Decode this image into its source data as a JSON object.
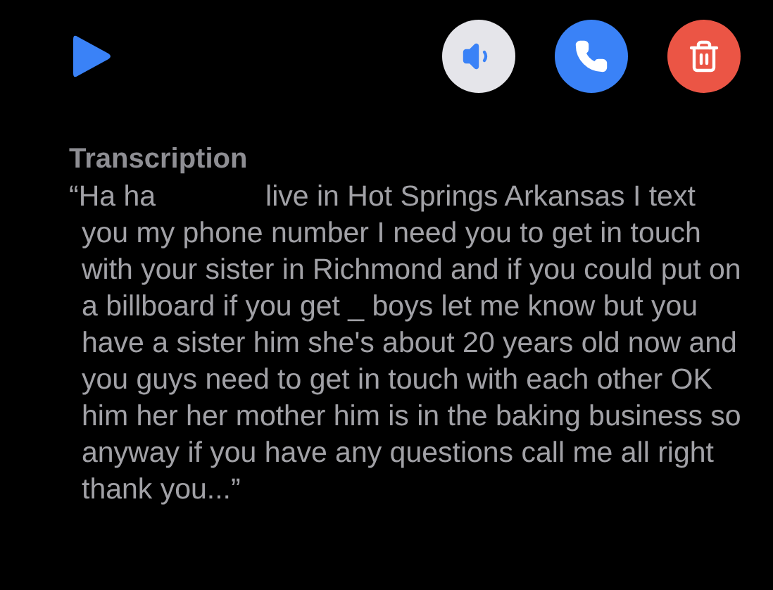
{
  "toolbar": {
    "buttons": [
      {
        "kind": "speaker"
      },
      {
        "kind": "call"
      },
      {
        "kind": "delete"
      }
    ]
  },
  "transcription": {
    "heading": "Transcription",
    "text_before": "“Ha ha",
    "text_after": "live in Hot Springs Arkansas I text you my phone number I need you to get in touch with your sister in Richmond and if you could put on a billboard if you get _ boys let me know but you have a sister him she's about 20 years old now and you guys need to get in touch with each other OK him her her mother him is in the baking business so anyway if you have any questions call me all right thank you...”"
  }
}
